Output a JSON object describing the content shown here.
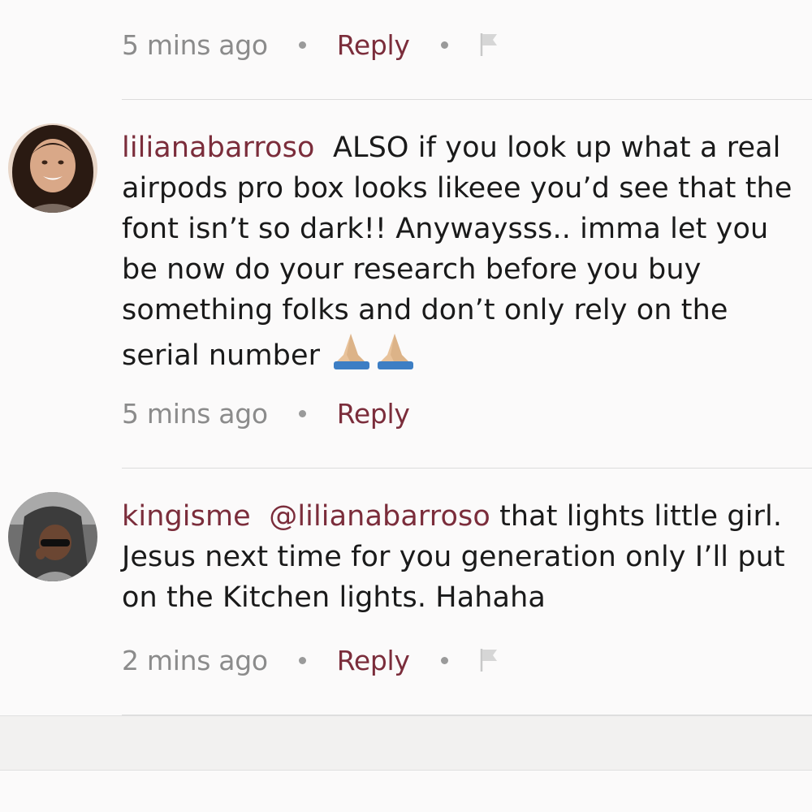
{
  "colors": {
    "accent": "#7b2d3b",
    "meta_text": "#8b8b8b",
    "body_text": "#1a1a1a",
    "background": "#fbfafa",
    "divider": "#dcdcdc"
  },
  "top_meta": {
    "time": "5 mins ago",
    "reply_label": "Reply",
    "has_flag": true
  },
  "comments": [
    {
      "username": "lilianabarroso",
      "avatar": "avatar-photo-woman",
      "mention": "",
      "text": "ALSO if you look up what a real airpods pro box looks likeee you’d see that the font isn’t so dark!! Anywaysss.. imma let you be now do your research before you buy something folks and don’t only rely on the serial number",
      "emoji": "folded-hands-icon",
      "time": "5 mins ago",
      "reply_label": "Reply",
      "has_flag": false
    },
    {
      "username": "kingisme",
      "avatar": "avatar-photo-child",
      "mention": "@lilianabarroso",
      "text": "that lights little girl. Jesus next time for you generation only I’ll put on the Kitchen lights. Hahaha",
      "emoji": "",
      "time": "2 mins ago",
      "reply_label": "Reply",
      "has_flag": true
    }
  ]
}
